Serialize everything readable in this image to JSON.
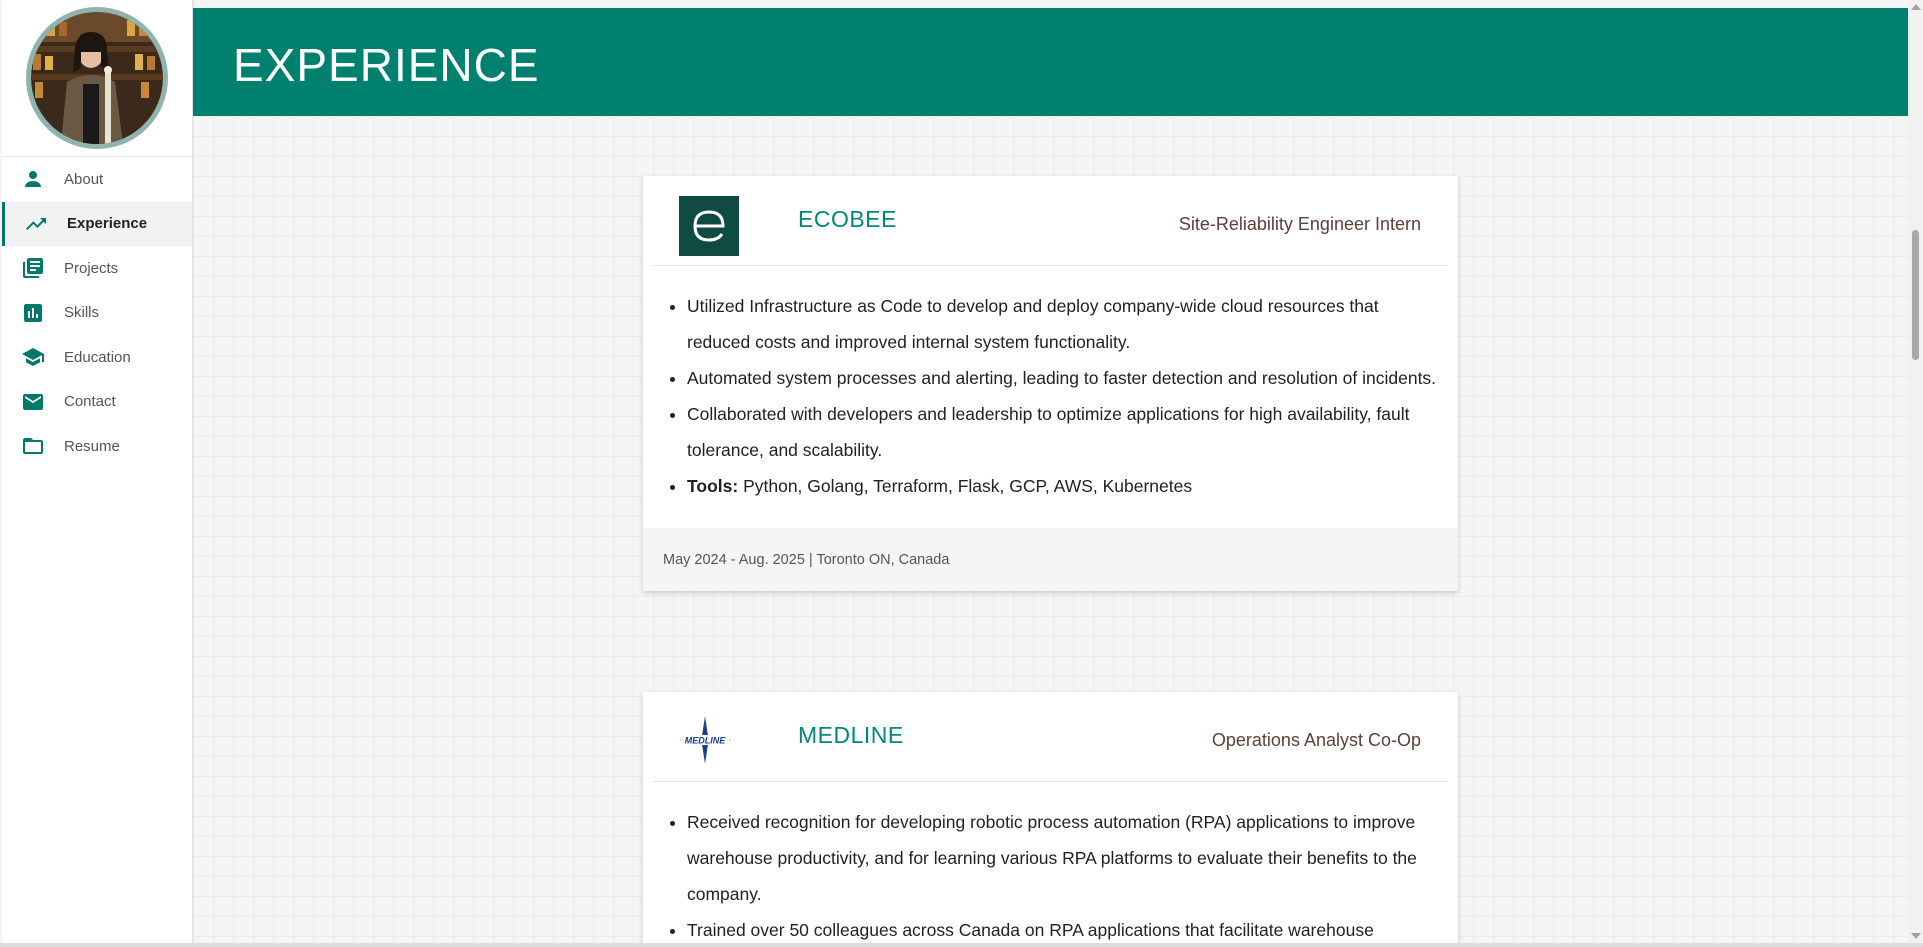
{
  "sidebar": {
    "items": [
      {
        "label": "About",
        "icon": "person-icon"
      },
      {
        "label": "Experience",
        "icon": "trending-up-icon",
        "active": true
      },
      {
        "label": "Projects",
        "icon": "library-books-icon"
      },
      {
        "label": "Skills",
        "icon": "bar-chart-icon"
      },
      {
        "label": "Education",
        "icon": "school-icon"
      },
      {
        "label": "Contact",
        "icon": "mail-icon"
      },
      {
        "label": "Resume",
        "icon": "folder-icon"
      }
    ]
  },
  "header": {
    "title": "EXPERIENCE"
  },
  "experiences": [
    {
      "logo": "ecobee-logo",
      "logo_letter": "e",
      "company": "ECOBEE",
      "role": "Site-Reliability Engineer Intern",
      "bullets": [
        "Utilized Infrastructure as Code to develop and deploy company-wide cloud resources that reduced costs and improved internal system functionality.",
        "Automated system processes and alerting, leading to faster detection and resolution of incidents.",
        "Collaborated with developers and leadership to optimize applications for high availability, fault tolerance, and scalability."
      ],
      "tools_label": "Tools:",
      "tools": " Python, Golang, Terraform, Flask, GCP, AWS, Kubernetes",
      "footer": "May 2024 - Aug. 2025 | Toronto ON, Canada"
    },
    {
      "logo": "medline-logo",
      "logo_text": "MEDLINE",
      "company": "MEDLINE",
      "role": "Operations Analyst Co-Op",
      "bullets": [
        "Received recognition for developing robotic process automation (RPA) applications to improve warehouse productivity, and for learning various RPA platforms to evaluate their benefits to the company.",
        "Trained over 50 colleagues across Canada on RPA applications that facilitate warehouse"
      ]
    }
  ],
  "colors": {
    "accent": "#00816f",
    "company_text": "#00897b",
    "role_text": "#5d4037"
  }
}
